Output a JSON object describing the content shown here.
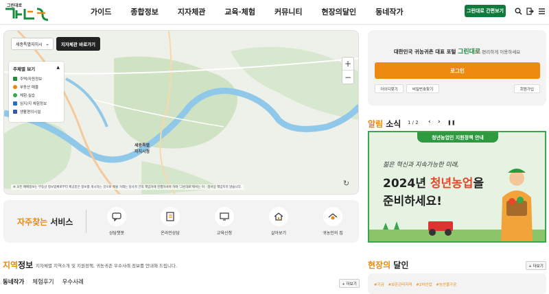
{
  "header": {
    "logo_small": "그린대로",
    "nav": [
      "가이드",
      "종합정보",
      "지자체관",
      "교육·체험",
      "커뮤니티",
      "현장의달인",
      "동네작가"
    ],
    "quick_button": "그린대로 간편보기"
  },
  "map": {
    "region_select": "세종특별자치시",
    "tour_button": "지자체관 바로가기",
    "legend_title": "주제별 보기",
    "legend_items": [
      {
        "label": "주택/자원정보",
        "color": "#2a8a3c"
      },
      {
        "label": "부동산 매물",
        "color": "#e8890c"
      },
      {
        "label": "체험·실습",
        "color": "#3aa54a"
      },
      {
        "label": "임지/지 체험정보",
        "color": "#2a6bc4"
      },
      {
        "label": "생활편의시설",
        "color": "#3458a6"
      }
    ],
    "labels": [
      {
        "text": "세종특별",
        "sub": "자치시청"
      }
    ],
    "disclaimer": "※ 모든 매매정보는 부동산 정보업체로부터 제공받은 정보를 게시하는 것으로 매물 거래는 당사자 간의 책임하에 진행하셔야 하며 '그린대로'에서는 이 · 정서상 책임지지 않습니다."
  },
  "services": {
    "title_accent": "자주찾는",
    "title_rest": " 서비스",
    "items": [
      "상담챗봇",
      "온라인상담",
      "교육신청",
      "살아보기",
      "귀농인의 집"
    ]
  },
  "region_info": {
    "title_accent": "지역",
    "title_rest": "정보",
    "subtitle": "지자체별 지역소개 및 지원정책, 귀농귀촌 우수사례 정보를 안내해 드립니다.",
    "tabs": [
      "동네작가",
      "체험후기",
      "우수사례"
    ],
    "more": "+ 더보기"
  },
  "login": {
    "line_pre": "대한민국 귀농귀촌 대표 포털 ",
    "brand": "그린대로",
    "line_post": " 편리하게 이용하세요",
    "login_button": "로그인",
    "find_id": "아이디찾기",
    "find_pw": "비밀번호찾기",
    "signup": "회원가입"
  },
  "notice": {
    "title_accent": "알림",
    "title_rest": " 소식",
    "page": "1 / 2",
    "banner_top": "청년농업인 지원정책 안내",
    "banner_l1": "젊은 혁신과 지속가능한 미래,",
    "banner_l2_pre": "2024년 ",
    "banner_l2_hl": "청년농업",
    "banner_l2_post": "을",
    "banner_l3": "준비하세요!"
  },
  "masters": {
    "title_accent": "현장의",
    "title_rest": " 달인",
    "more": "+ 더보기",
    "tags": [
      "#기금",
      "#보존관리자격",
      "#2차산업",
      "#농산물가공"
    ]
  },
  "colors": {
    "brand_green": "#0f7a3c",
    "accent_orange": "#e8890c",
    "login_orange": "#ef8a10"
  }
}
